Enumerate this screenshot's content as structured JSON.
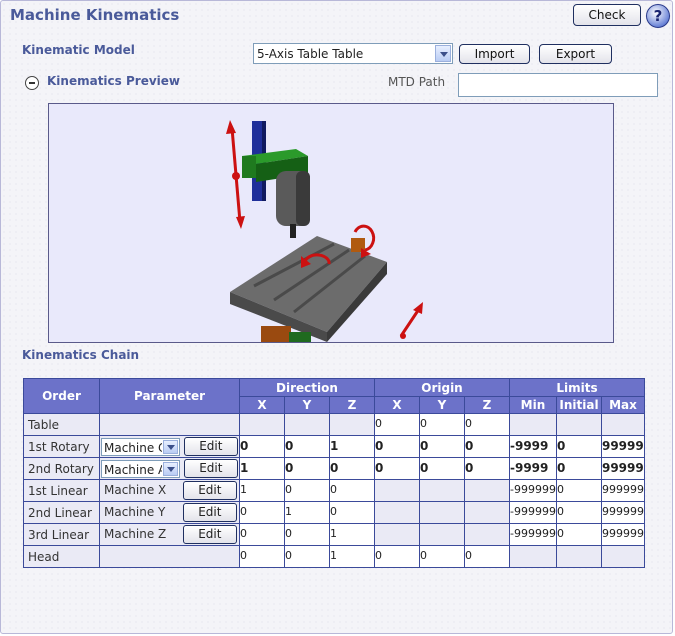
{
  "window": {
    "title": "Machine Kinematics"
  },
  "header": {
    "check_label": "Check",
    "help_label": "?"
  },
  "model": {
    "label": "Kinematic Model",
    "selected": "5-Axis Table Table",
    "import_label": "Import",
    "export_label": "Export"
  },
  "preview": {
    "label": "Kinematics Preview",
    "mtd_label": "MTD Path",
    "mtd_value": ""
  },
  "chain": {
    "label": "Kinematics Chain",
    "headers": {
      "order": "Order",
      "parameter": "Parameter",
      "direction": "Direction",
      "origin": "Origin",
      "limits": "Limits",
      "x": "X",
      "y": "Y",
      "z": "Z",
      "min": "Min",
      "initial": "Initial",
      "max": "Max"
    },
    "edit_label": "Edit",
    "rows": [
      {
        "order": "Table",
        "param": "",
        "dir": [
          "",
          "",
          ""
        ],
        "orig": [
          "0",
          "0",
          "0"
        ],
        "lim": [
          "",
          "",
          ""
        ]
      },
      {
        "order": "1st Rotary",
        "param": "Machine C",
        "dir": [
          "0",
          "0",
          "1"
        ],
        "orig": [
          "0",
          "0",
          "0"
        ],
        "lim": [
          "-9999",
          "0",
          "99999"
        ]
      },
      {
        "order": "2nd Rotary",
        "param": "Machine A",
        "dir": [
          "1",
          "0",
          "0"
        ],
        "orig": [
          "0",
          "0",
          "0"
        ],
        "lim": [
          "-9999",
          "0",
          "99999"
        ]
      },
      {
        "order": "1st Linear",
        "param": "Machine X",
        "dir": [
          "1",
          "0",
          "0"
        ],
        "orig": [
          "",
          "",
          ""
        ],
        "lim": [
          "-999999",
          "0",
          "999999"
        ]
      },
      {
        "order": "2nd Linear",
        "param": "Machine Y",
        "dir": [
          "0",
          "1",
          "0"
        ],
        "orig": [
          "",
          "",
          ""
        ],
        "lim": [
          "-999999",
          "0",
          "999999"
        ]
      },
      {
        "order": "3rd Linear",
        "param": "Machine Z",
        "dir": [
          "0",
          "0",
          "1"
        ],
        "orig": [
          "",
          "",
          ""
        ],
        "lim": [
          "-999999",
          "0",
          "999999"
        ]
      },
      {
        "order": "Head",
        "param": "",
        "dir": [
          "0",
          "0",
          "1"
        ],
        "orig": [
          "0",
          "0",
          "0"
        ],
        "lim": [
          "",
          "",
          ""
        ]
      }
    ]
  },
  "colors": {
    "accent": "#4a5a9a",
    "table_header": "#6c72c9",
    "preview_bg": "#e9e9fb"
  }
}
